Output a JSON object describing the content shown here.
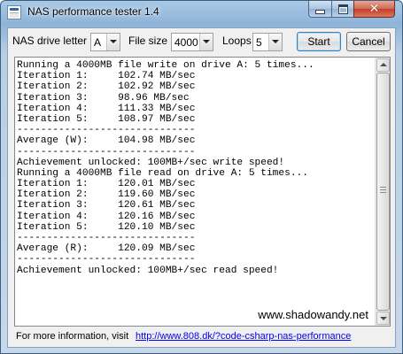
{
  "window": {
    "title": "NAS performance tester 1.4",
    "close_glyph": "✕"
  },
  "controls": {
    "drive_label": "NAS drive letter",
    "drive_value": "A",
    "filesize_label": "File size",
    "filesize_value": "4000",
    "loops_label": "Loops",
    "loops_value": "5",
    "start_label": "Start",
    "cancel_label": "Cancel"
  },
  "output": {
    "lines": [
      "Running a 4000MB file write on drive A: 5 times...",
      "Iteration 1:     102.74 MB/sec",
      "Iteration 2:     102.92 MB/sec",
      "Iteration 3:     98.96 MB/sec",
      "Iteration 4:     111.33 MB/sec",
      "Iteration 5:     108.97 MB/sec",
      "------------------------------",
      "Average (W):     104.98 MB/sec",
      "------------------------------",
      "Achievement unlocked: 100MB+/sec write speed!",
      "Running a 4000MB file read on drive A: 5 times...",
      "Iteration 1:     120.01 MB/sec",
      "Iteration 2:     119.60 MB/sec",
      "Iteration 3:     120.61 MB/sec",
      "Iteration 4:     120.16 MB/sec",
      "Iteration 5:     120.10 MB/sec",
      "------------------------------",
      "Average (R):     120.09 MB/sec",
      "------------------------------",
      "Achievement unlocked: 100MB+/sec read speed!"
    ],
    "watermark": "www.shadowandy.net"
  },
  "footer": {
    "info_text": "For more information, visit",
    "link_text": "http://www.808.dk/?code-csharp-nas-performance"
  },
  "icons": {
    "app": "app-window-icon",
    "minimize": "minimize-icon",
    "maximize": "maximize-icon",
    "close": "close-icon",
    "dropdown": "chevron-down-icon"
  },
  "colors": {
    "titlebar": "#a9c9e6",
    "close_button": "#c2402a",
    "link": "#0000ff",
    "client_background": "#f0f0f0"
  }
}
